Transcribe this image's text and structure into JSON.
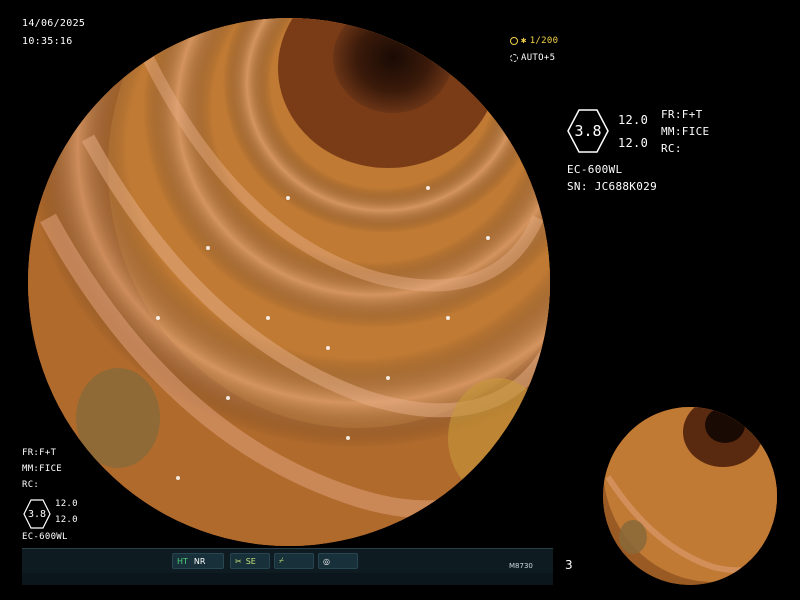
{
  "overlay": {
    "date": "14/06/2025",
    "time": "10:35:16",
    "magnification": "1/200",
    "auto_level": "AUTO+5"
  },
  "info_panel": {
    "hex_value": "3.8",
    "right_top": "12.0",
    "right_bottom": "12.0",
    "fr": "FR:F+T",
    "mm": "MM:FICE",
    "rc": "RC:",
    "scope_model": "EC-600WL",
    "serial": "SN: JC688K029"
  },
  "bottom_left_panel": {
    "fr": "FR:F+T",
    "mm": "MM:FICE",
    "rc": "RC:",
    "hex_value": "3.8",
    "right_top": "12.0",
    "right_bottom": "12.0",
    "scope_model": "EC-600WL"
  },
  "status_bar": {
    "ht_label": "HT",
    "nr_label": "NR",
    "se_label": "SE",
    "model_code": "M8730",
    "page_number": "3",
    "icons": [
      "scissors-icon",
      "slash-icon",
      "circle-target-icon"
    ]
  },
  "colors": {
    "overlay_yellow": "#f2d24a",
    "status_green": "#4fd27a",
    "status_bar_bg": "#0e1c22"
  }
}
